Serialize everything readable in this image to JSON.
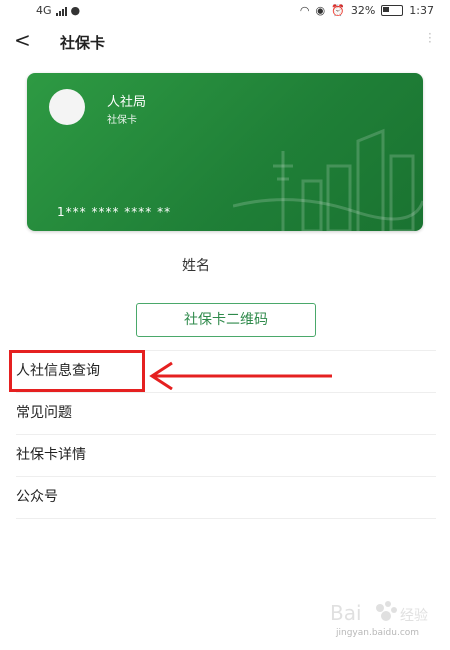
{
  "status_bar": {
    "network": "4G",
    "battery": "32%",
    "time": "1:37"
  },
  "header": {
    "title": "社保卡"
  },
  "card": {
    "issuer": "人社局",
    "subtitle": "社保卡",
    "number": "1*** **** **** **"
  },
  "holder": {
    "name_label": "姓名"
  },
  "qr_button": {
    "label": "社保卡二维码"
  },
  "menu": {
    "items": [
      {
        "label": "人社信息查询"
      },
      {
        "label": "常见问题"
      },
      {
        "label": "社保卡详情"
      },
      {
        "label": "公众号"
      }
    ]
  },
  "watermark": {
    "text": "jingyan.baidu.com"
  },
  "colors": {
    "card_green": "#1f7f37",
    "accent_green": "#4aa86a",
    "annotation_red": "#e52020"
  }
}
